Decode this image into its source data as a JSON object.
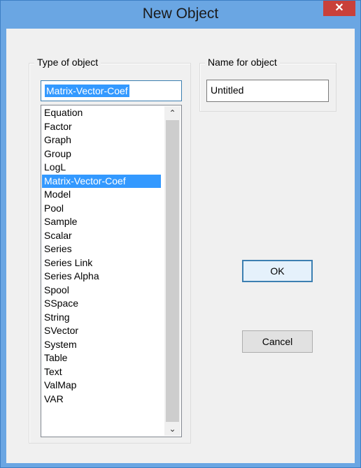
{
  "window": {
    "title": "New Object",
    "close_glyph": "✕"
  },
  "type_group": {
    "label": "Type of object",
    "input_value": "Matrix-Vector-Coef",
    "items": [
      "Equation",
      "Factor",
      "Graph",
      "Group",
      "LogL",
      "Matrix-Vector-Coef",
      "Model",
      "Pool",
      "Sample",
      "Scalar",
      "Series",
      "Series Link",
      "Series Alpha",
      "Spool",
      "SSpace",
      "String",
      "SVector",
      "System",
      "Table",
      "Text",
      "ValMap",
      "VAR"
    ],
    "selected_item": "Matrix-Vector-Coef",
    "scroll_up_glyph": "⌃",
    "scroll_down_glyph": "⌄"
  },
  "name_group": {
    "label": "Name for object",
    "input_value": "Untitled"
  },
  "buttons": {
    "ok_label": "OK",
    "cancel_label": "Cancel"
  },
  "colors": {
    "title_bar": "#6aa6e3",
    "close_button": "#c9403a",
    "selection": "#3399ff"
  }
}
